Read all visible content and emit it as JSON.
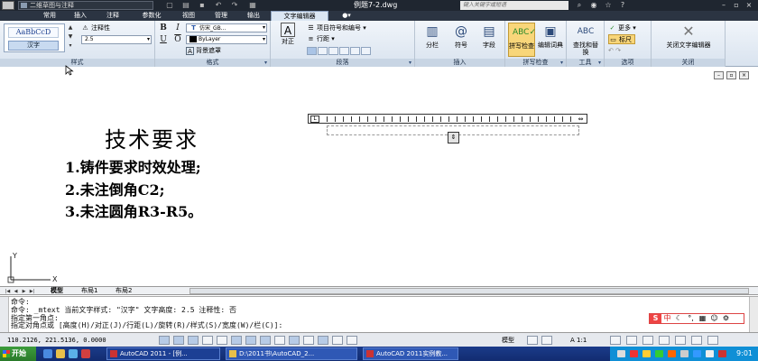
{
  "titlebar": {
    "workspace": "二维草图与注释",
    "filename": "例题7-2.dwg",
    "search_placeholder": "键入关键字或短语"
  },
  "ribbon_tabs": [
    "常用",
    "插入",
    "注释",
    "参数化",
    "视图",
    "管理",
    "输出",
    "文字编辑器"
  ],
  "style_panel": {
    "sample_text": "AaBbCcD",
    "style_name": "汉字",
    "annotative_label": "注释性",
    "height_value": "2.5",
    "label": "样式"
  },
  "format_panel": {
    "font_value": "仿宋_GB...",
    "color_value": "ByLayer",
    "background_mask_label": "背景遮罩",
    "label": "格式"
  },
  "paragraph_panel": {
    "justify_label": "对正",
    "bullets_label": "项目符号和编号",
    "line_spacing_label": "行距",
    "label": "段落"
  },
  "insert_panel": {
    "columns_label": "分栏",
    "symbol_label": "符号",
    "field_label": "字段",
    "label": "插入"
  },
  "spell_panel": {
    "spell_check_label": "拼写检查",
    "dictionary_label": "编辑词典",
    "label": "拼写检查"
  },
  "tools_panel": {
    "find_replace_label": "查找和替换",
    "label": "工具"
  },
  "options_panel": {
    "more_label": "更多",
    "ruler_label": "标尺",
    "label": "选项"
  },
  "close_panel": {
    "close_label": "关闭文字编辑器",
    "label": "关闭"
  },
  "drawing": {
    "title": "技术要求",
    "lines": [
      "1.铸件要求时效处理;",
      "2.未注倒角C2;",
      "3.未注圆角R3-R5。"
    ],
    "ucs_y": "Y",
    "ucs_x": "X"
  },
  "layout_tabs": [
    "模型",
    "布局1",
    "布局2"
  ],
  "command": {
    "line1": "命令:",
    "line2": "命令: _mtext 当前文字样式: \"汉字\" 文字高度: 2.5 注释性: 否",
    "line3": "指定第一角点:",
    "line4": "指定对角点或 [高度(H)/对正(J)/行距(L)/旋转(R)/样式(S)/宽度(W)/栏(C)]:"
  },
  "ime": {
    "s_label": "S",
    "lang": "中"
  },
  "status": {
    "coords": "110.2126, 221.5136, 0.0000",
    "model_label": "模型",
    "scale": "A 1:1"
  },
  "taskbar": {
    "start_label": "开始",
    "tasks": [
      "AutoCAD 2011 - [例...",
      "D:\\2011书\\AutoCAD_2...",
      "AutoCAD 2011实例教..."
    ],
    "clock": "9:01"
  },
  "colors": {
    "title_bg": "#1f2630",
    "ribbon_bg": "#dbe6f3",
    "taskbar_bg": "#1b3b8a",
    "start_bg": "#3c9b3c",
    "tray_bg": "#0f8fd6"
  }
}
